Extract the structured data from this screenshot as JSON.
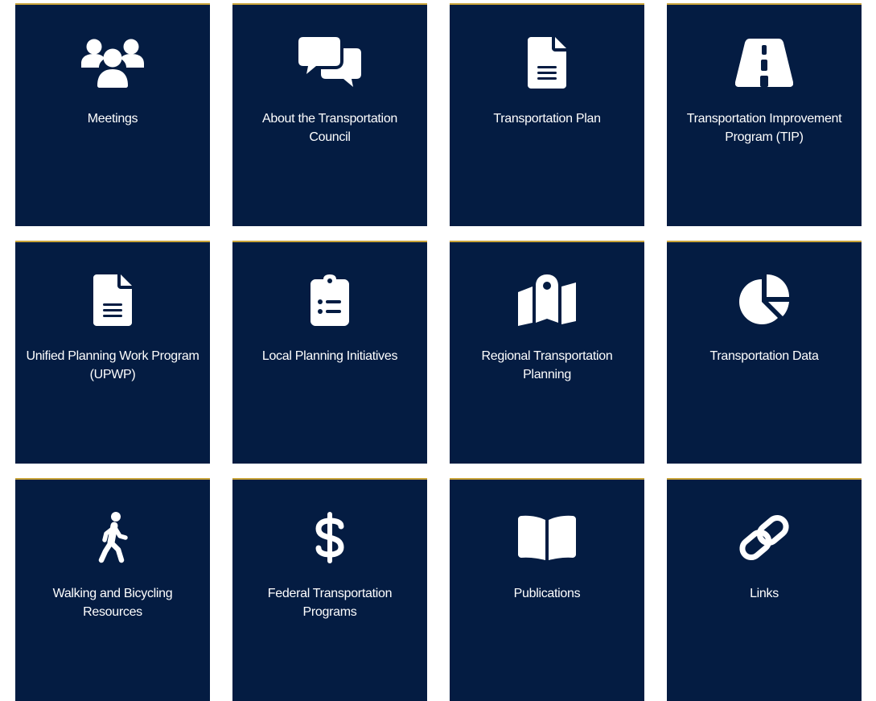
{
  "tiles": [
    {
      "label": "Meetings",
      "icon": "people-group-icon"
    },
    {
      "label": "About the Transportation Council",
      "icon": "chat-bubbles-icon"
    },
    {
      "label": "Transportation Plan",
      "icon": "document-icon"
    },
    {
      "label": "Transportation Improvement Program (TIP)",
      "icon": "road-icon"
    },
    {
      "label": "Unified Planning Work Program (UPWP)",
      "icon": "document-icon"
    },
    {
      "label": "Local Planning Initiatives",
      "icon": "clipboard-list-icon"
    },
    {
      "label": "Regional Transportation Planning",
      "icon": "map-pin-icon"
    },
    {
      "label": "Transportation Data",
      "icon": "pie-chart-icon"
    },
    {
      "label": "Walking and Bicycling Resources",
      "icon": "walking-person-icon"
    },
    {
      "label": "Federal Transportation Programs",
      "icon": "dollar-sign-icon"
    },
    {
      "label": "Publications",
      "icon": "open-book-icon"
    },
    {
      "label": "Links",
      "icon": "link-icon"
    }
  ],
  "colors": {
    "tile_background": "#041c42",
    "tile_top_border": "#c9a43a",
    "text": "#ffffff",
    "page_background": "#ffffff"
  }
}
